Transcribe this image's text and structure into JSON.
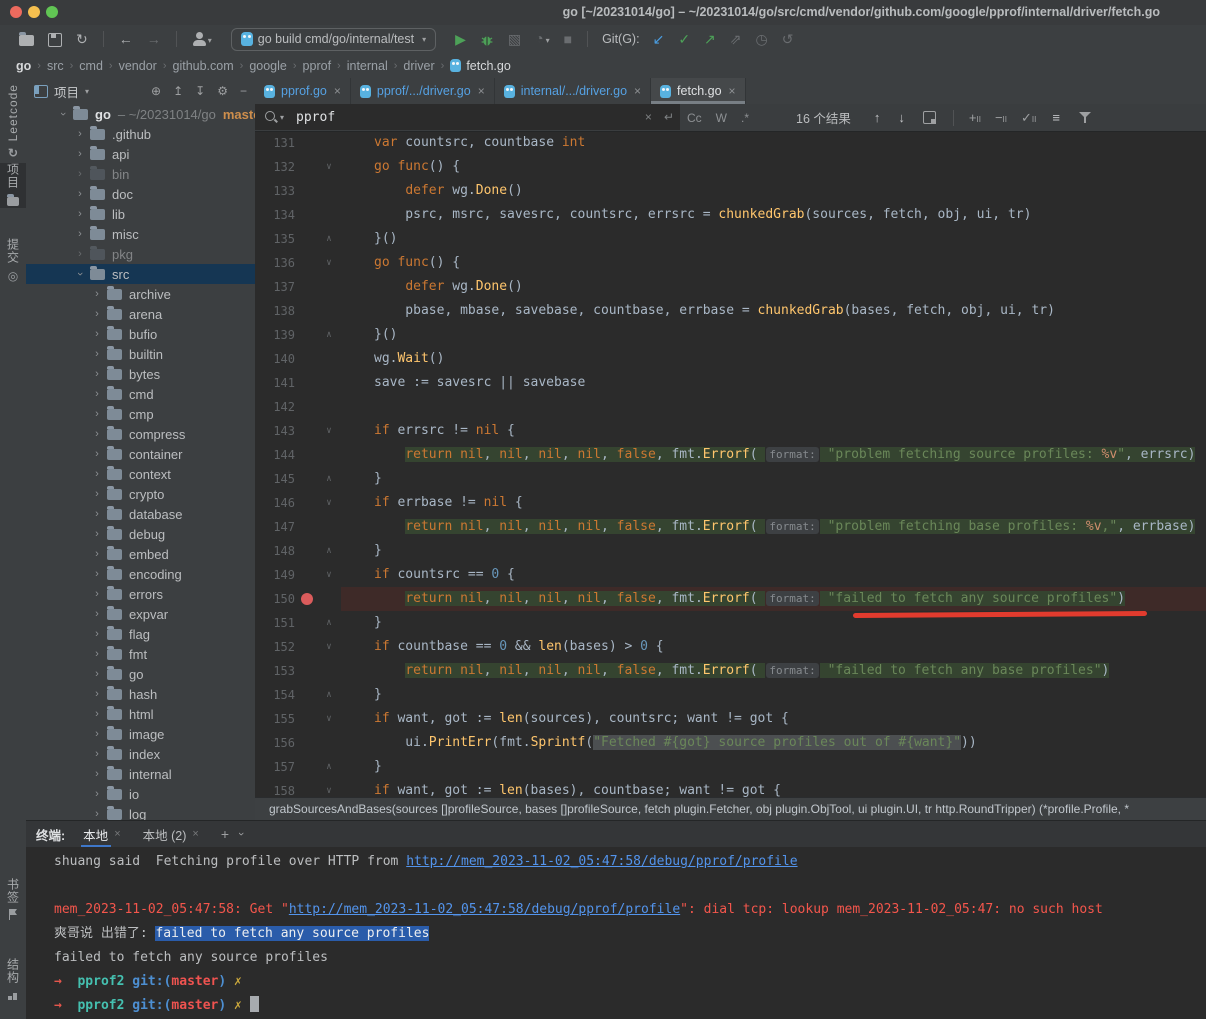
{
  "window": {
    "title": "go [~/20231014/go] – ~/20231014/go/src/cmd/vendor/github.com/google/pprof/internal/driver/fetch.go"
  },
  "toolbar": {
    "run_config": "go build cmd/go/internal/test",
    "git_label": "Git(G):"
  },
  "breadcrumbs": {
    "items": [
      "go",
      "src",
      "cmd",
      "vendor",
      "github.com",
      "google",
      "pprof",
      "internal",
      "driver",
      "fetch.go"
    ]
  },
  "tool_strip": {
    "top": [
      {
        "label": "Leetcode",
        "icon": "leetcode-icon"
      },
      {
        "label": "项目",
        "icon": "folder-icon",
        "active": true
      },
      {
        "label": "提交",
        "icon": "commit-icon"
      }
    ],
    "bottom": [
      {
        "label": "书签",
        "icon": "bookmark-flag-icon"
      },
      {
        "label": "结构",
        "icon": "structure-icon"
      }
    ]
  },
  "project": {
    "header": "项目",
    "tree": [
      {
        "name": "go",
        "level": 0,
        "expanded": true,
        "root": true,
        "path": "– ~/20231014/go",
        "branch": "master"
      },
      {
        "name": ".github",
        "level": 1
      },
      {
        "name": "api",
        "level": 1
      },
      {
        "name": "bin",
        "level": 1,
        "dim": true
      },
      {
        "name": "doc",
        "level": 1
      },
      {
        "name": "lib",
        "level": 1
      },
      {
        "name": "misc",
        "level": 1
      },
      {
        "name": "pkg",
        "level": 1,
        "dim": true
      },
      {
        "name": "src",
        "level": 1,
        "expanded": true,
        "selected": true
      },
      {
        "name": "archive",
        "level": 2
      },
      {
        "name": "arena",
        "level": 2
      },
      {
        "name": "bufio",
        "level": 2
      },
      {
        "name": "builtin",
        "level": 2
      },
      {
        "name": "bytes",
        "level": 2
      },
      {
        "name": "cmd",
        "level": 2
      },
      {
        "name": "cmp",
        "level": 2
      },
      {
        "name": "compress",
        "level": 2
      },
      {
        "name": "container",
        "level": 2
      },
      {
        "name": "context",
        "level": 2
      },
      {
        "name": "crypto",
        "level": 2
      },
      {
        "name": "database",
        "level": 2
      },
      {
        "name": "debug",
        "level": 2
      },
      {
        "name": "embed",
        "level": 2
      },
      {
        "name": "encoding",
        "level": 2
      },
      {
        "name": "errors",
        "level": 2
      },
      {
        "name": "expvar",
        "level": 2
      },
      {
        "name": "flag",
        "level": 2
      },
      {
        "name": "fmt",
        "level": 2
      },
      {
        "name": "go",
        "level": 2
      },
      {
        "name": "hash",
        "level": 2
      },
      {
        "name": "html",
        "level": 2
      },
      {
        "name": "image",
        "level": 2
      },
      {
        "name": "index",
        "level": 2
      },
      {
        "name": "internal",
        "level": 2
      },
      {
        "name": "io",
        "level": 2
      },
      {
        "name": "log",
        "level": 2
      }
    ]
  },
  "editor": {
    "tabs": [
      {
        "label": "pprof.go"
      },
      {
        "label": "pprof/.../driver.go"
      },
      {
        "label": "internal/.../driver.go"
      },
      {
        "label": "fetch.go",
        "active": true
      }
    ],
    "search": {
      "query": "pprof",
      "results": "16 个结果",
      "toggles": [
        "Cc",
        "W",
        ".*"
      ]
    },
    "signature": "grabSourcesAndBases(sources []profileSource, bases []profileSource, fetch plugin.Fetcher, obj plugin.ObjTool, ui plugin.UI, tr http.RoundTripper) (*profile.Profile, *",
    "lines": [
      {
        "n": 131,
        "t": [
          [
            "k",
            "var"
          ],
          [
            "p",
            " countsrc, countbase "
          ],
          [
            "k",
            "int"
          ]
        ]
      },
      {
        "n": 132,
        "fold": "open",
        "t": [
          [
            "k",
            "go"
          ],
          [
            "p",
            " "
          ],
          [
            "k",
            "func"
          ],
          [
            "p",
            "() {"
          ]
        ]
      },
      {
        "n": 133,
        "fold": "cont",
        "t": [
          [
            "p",
            "    "
          ],
          [
            "k",
            "defer"
          ],
          [
            "p",
            " wg."
          ],
          [
            "f",
            "Done"
          ],
          [
            "p",
            "()"
          ]
        ]
      },
      {
        "n": 134,
        "fold": "cont",
        "t": [
          [
            "p",
            "    psrc, msrc, savesrc, countsrc, errsrc = "
          ],
          [
            "f",
            "chunkedGrab"
          ],
          [
            "p",
            "(sources, fetch, obj, ui, tr)"
          ]
        ]
      },
      {
        "n": 135,
        "fold": "close",
        "t": [
          [
            "p",
            "}()"
          ]
        ]
      },
      {
        "n": 136,
        "fold": "open",
        "t": [
          [
            "k",
            "go"
          ],
          [
            "p",
            " "
          ],
          [
            "k",
            "func"
          ],
          [
            "p",
            "() {"
          ]
        ]
      },
      {
        "n": 137,
        "fold": "cont",
        "t": [
          [
            "p",
            "    "
          ],
          [
            "k",
            "defer"
          ],
          [
            "p",
            " wg."
          ],
          [
            "f",
            "Done"
          ],
          [
            "p",
            "()"
          ]
        ]
      },
      {
        "n": 138,
        "fold": "cont",
        "t": [
          [
            "p",
            "    pbase, mbase, savebase, countbase, errbase = "
          ],
          [
            "f",
            "chunkedGrab"
          ],
          [
            "p",
            "(bases, fetch, obj, ui, tr)"
          ]
        ]
      },
      {
        "n": 139,
        "fold": "close",
        "t": [
          [
            "p",
            "}()"
          ]
        ]
      },
      {
        "n": 140,
        "t": [
          [
            "p",
            "wg."
          ],
          [
            "f",
            "Wait"
          ],
          [
            "p",
            "()"
          ]
        ]
      },
      {
        "n": 141,
        "t": [
          [
            "p",
            "save := savesrc || savebase"
          ]
        ]
      },
      {
        "n": 142,
        "t": []
      },
      {
        "n": 143,
        "fold": "open",
        "t": [
          [
            "k",
            "if"
          ],
          [
            "p",
            " errsrc != "
          ],
          [
            "k",
            "nil"
          ],
          [
            "p",
            " {"
          ]
        ]
      },
      {
        "n": 144,
        "fold": "cont",
        "t": [
          [
            "p",
            "    "
          ],
          [
            "k",
            "return",
            "g"
          ],
          [
            "p",
            " ",
            "g"
          ],
          [
            "k",
            "nil",
            "g"
          ],
          [
            "p",
            ", ",
            "g"
          ],
          [
            "k",
            "nil",
            "g"
          ],
          [
            "p",
            ", ",
            "g"
          ],
          [
            "k",
            "nil",
            "g"
          ],
          [
            "p",
            ", ",
            "g"
          ],
          [
            "k",
            "nil",
            "g"
          ],
          [
            "p",
            ", ",
            "g"
          ],
          [
            "k",
            "false",
            "g"
          ],
          [
            "p",
            ", fmt.",
            "g"
          ],
          [
            "f",
            "Errorf",
            "g"
          ],
          [
            "p",
            "( ",
            "g"
          ],
          [
            "i",
            "format:"
          ],
          [
            "p",
            " ",
            "g"
          ],
          [
            "s",
            "\"problem fetching source profiles: ",
            "g"
          ],
          [
            "v",
            "%v",
            "g"
          ],
          [
            "s",
            "\"",
            "g"
          ],
          [
            "p",
            ", errsrc)",
            "g"
          ]
        ]
      },
      {
        "n": 145,
        "fold": "close",
        "t": [
          [
            "p",
            "}"
          ]
        ]
      },
      {
        "n": 146,
        "fold": "open",
        "t": [
          [
            "k",
            "if"
          ],
          [
            "p",
            " errbase != "
          ],
          [
            "k",
            "nil"
          ],
          [
            "p",
            " {"
          ]
        ]
      },
      {
        "n": 147,
        "fold": "cont",
        "t": [
          [
            "p",
            "    "
          ],
          [
            "k",
            "return",
            "g"
          ],
          [
            "p",
            " ",
            "g"
          ],
          [
            "k",
            "nil",
            "g"
          ],
          [
            "p",
            ", ",
            "g"
          ],
          [
            "k",
            "nil",
            "g"
          ],
          [
            "p",
            ", ",
            "g"
          ],
          [
            "k",
            "nil",
            "g"
          ],
          [
            "p",
            ", ",
            "g"
          ],
          [
            "k",
            "nil",
            "g"
          ],
          [
            "p",
            ", ",
            "g"
          ],
          [
            "k",
            "false",
            "g"
          ],
          [
            "p",
            ", fmt.",
            "g"
          ],
          [
            "f",
            "Errorf",
            "g"
          ],
          [
            "p",
            "( ",
            "g"
          ],
          [
            "i",
            "format:"
          ],
          [
            "p",
            " ",
            "g"
          ],
          [
            "s",
            "\"problem fetching base profiles: ",
            "g"
          ],
          [
            "v",
            "%v",
            "g"
          ],
          [
            "s",
            ",\"",
            "g"
          ],
          [
            "p",
            ", errbase)",
            "g"
          ]
        ]
      },
      {
        "n": 148,
        "fold": "close",
        "t": [
          [
            "p",
            "}"
          ]
        ]
      },
      {
        "n": 149,
        "fold": "open",
        "t": [
          [
            "k",
            "if"
          ],
          [
            "p",
            " countsrc == "
          ],
          [
            "n",
            "0"
          ],
          [
            "p",
            " {"
          ]
        ]
      },
      {
        "n": 150,
        "fold": "cont",
        "bp": true,
        "row": "red",
        "t": [
          [
            "p",
            "    "
          ],
          [
            "k",
            "return",
            "g"
          ],
          [
            "p",
            " ",
            "g"
          ],
          [
            "k",
            "nil",
            "g"
          ],
          [
            "p",
            ", ",
            "g"
          ],
          [
            "k",
            "nil",
            "g"
          ],
          [
            "p",
            ", ",
            "g"
          ],
          [
            "k",
            "nil",
            "g"
          ],
          [
            "p",
            ", ",
            "g"
          ],
          [
            "k",
            "nil",
            "g"
          ],
          [
            "p",
            ", ",
            "g"
          ],
          [
            "k",
            "false",
            "g"
          ],
          [
            "p",
            ", fmt.",
            "g"
          ],
          [
            "f",
            "Errorf",
            "g"
          ],
          [
            "p",
            "( ",
            "g"
          ],
          [
            "i",
            "format:"
          ],
          [
            "p",
            " ",
            "g"
          ],
          [
            "s",
            "\"failed to fetch any source profiles\"",
            "g"
          ],
          [
            "p",
            ")",
            "g"
          ]
        ]
      },
      {
        "n": 151,
        "fold": "close",
        "t": [
          [
            "p",
            "}"
          ]
        ]
      },
      {
        "n": 152,
        "fold": "open",
        "t": [
          [
            "k",
            "if"
          ],
          [
            "p",
            " countbase == "
          ],
          [
            "n",
            "0"
          ],
          [
            "p",
            " && "
          ],
          [
            "f",
            "len"
          ],
          [
            "p",
            "(bases) > "
          ],
          [
            "n",
            "0"
          ],
          [
            "p",
            " {"
          ]
        ]
      },
      {
        "n": 153,
        "fold": "cont",
        "t": [
          [
            "p",
            "    "
          ],
          [
            "k",
            "return",
            "g"
          ],
          [
            "p",
            " ",
            "g"
          ],
          [
            "k",
            "nil",
            "g"
          ],
          [
            "p",
            ", ",
            "g"
          ],
          [
            "k",
            "nil",
            "g"
          ],
          [
            "p",
            ", ",
            "g"
          ],
          [
            "k",
            "nil",
            "g"
          ],
          [
            "p",
            ", ",
            "g"
          ],
          [
            "k",
            "nil",
            "g"
          ],
          [
            "p",
            ", ",
            "g"
          ],
          [
            "k",
            "false",
            "g"
          ],
          [
            "p",
            ", fmt.",
            "g"
          ],
          [
            "f",
            "Errorf",
            "g"
          ],
          [
            "p",
            "( ",
            "g"
          ],
          [
            "i",
            "format:"
          ],
          [
            "p",
            " ",
            "g"
          ],
          [
            "s",
            "\"failed to fetch any base profiles\"",
            "g"
          ],
          [
            "p",
            ")",
            "g"
          ]
        ]
      },
      {
        "n": 154,
        "fold": "close",
        "t": [
          [
            "p",
            "}"
          ]
        ]
      },
      {
        "n": 155,
        "fold": "open",
        "t": [
          [
            "k",
            "if"
          ],
          [
            "p",
            " want, got := "
          ],
          [
            "f",
            "len"
          ],
          [
            "p",
            "(sources), countsrc; want != got {"
          ]
        ]
      },
      {
        "n": 156,
        "fold": "cont",
        "t": [
          [
            "p",
            "    ui."
          ],
          [
            "f",
            "PrintErr"
          ],
          [
            "p",
            "(fmt."
          ],
          [
            "f",
            "Sprintf"
          ],
          [
            "p",
            "("
          ],
          [
            "s",
            "\"Fetched #{got} source profiles out of #{want}\"",
            "x"
          ],
          [
            "p",
            "))"
          ]
        ]
      },
      {
        "n": 157,
        "fold": "close",
        "t": [
          [
            "p",
            "}"
          ]
        ]
      },
      {
        "n": 158,
        "fold": "open",
        "t": [
          [
            "k",
            "if"
          ],
          [
            "p",
            " want, got := "
          ],
          [
            "f",
            "len"
          ],
          [
            "p",
            "(bases), countbase; want != got {"
          ]
        ]
      }
    ]
  },
  "terminal": {
    "label": "终端:",
    "tabs": [
      {
        "label": "本地",
        "active": true
      },
      {
        "label": "本地 (2)"
      }
    ],
    "lines": [
      {
        "t": [
          [
            "p",
            "shuang said  Fetching profile over HTTP from "
          ],
          [
            "l",
            "http://mem_2023-11-02_05:47:58/debug/pprof/profile"
          ]
        ]
      },
      {
        "t": []
      },
      {
        "t": [
          [
            "e",
            "mem_2023-11-02_05:47:58: Get \""
          ],
          [
            "el",
            "http://mem_2023-11-02_05:47:58/debug/pprof/profile"
          ],
          [
            "e",
            "\": dial tcp: lookup mem_2023-11-02_05:47: no such host"
          ]
        ]
      },
      {
        "t": [
          [
            "p",
            "爽哥说 出错了: "
          ],
          [
            "sel",
            "failed to fetch any source profiles"
          ]
        ]
      },
      {
        "t": [
          [
            "p",
            "failed to fetch any source profiles"
          ]
        ]
      },
      {
        "t": [
          [
            "ar",
            "→"
          ],
          [
            "p",
            "  "
          ],
          [
            "dir",
            "pprof2"
          ],
          [
            "p",
            " "
          ],
          [
            "gb",
            "git:("
          ],
          [
            "br",
            "master"
          ],
          [
            "gb",
            ")"
          ],
          [
            "p",
            " "
          ],
          [
            "cx",
            "✗"
          ]
        ]
      },
      {
        "t": [
          [
            "ar",
            "→"
          ],
          [
            "p",
            "  "
          ],
          [
            "dir",
            "pprof2"
          ],
          [
            "p",
            " "
          ],
          [
            "gb",
            "git:("
          ],
          [
            "br",
            "master"
          ],
          [
            "gb",
            ")"
          ],
          [
            "p",
            " "
          ],
          [
            "cx",
            "✗"
          ],
          [
            "p",
            " "
          ],
          [
            "cur",
            ""
          ]
        ]
      }
    ]
  }
}
